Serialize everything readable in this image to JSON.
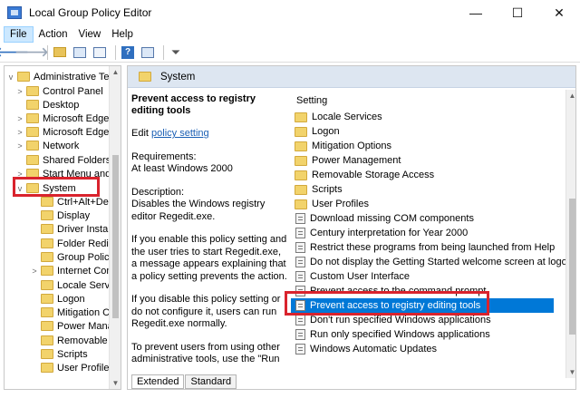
{
  "window": {
    "title": "Local Group Policy Editor",
    "minimize_glyph": "—",
    "maximize_glyph": "☐",
    "close_glyph": "✕"
  },
  "menu": [
    "File",
    "Action",
    "View",
    "Help"
  ],
  "toolbar_icons": [
    "back-arrow-icon",
    "forward-arrow-icon",
    "up-folder-icon",
    "show-hide-tree-icon",
    "export-list-icon",
    "help-icon",
    "properties-icon",
    "filter-icon"
  ],
  "tree": {
    "items": [
      {
        "label": "Administrative Templ",
        "chev": "v"
      },
      {
        "label": "Control Panel",
        "chev": ">"
      },
      {
        "label": "Desktop",
        "chev": ""
      },
      {
        "label": "Microsoft Edge",
        "chev": ">"
      },
      {
        "label": "Microsoft Edge",
        "chev": ">"
      },
      {
        "label": "Network",
        "chev": ">"
      },
      {
        "label": "Shared Folders",
        "chev": ""
      },
      {
        "label": "Start Menu and",
        "chev": ">"
      },
      {
        "label": "System",
        "chev": "v"
      },
      {
        "label": "Ctrl+Alt+De",
        "chev": ""
      },
      {
        "label": "Display",
        "chev": ""
      },
      {
        "label": "Driver Instal",
        "chev": ""
      },
      {
        "label": "Folder Redir",
        "chev": ""
      },
      {
        "label": "Group Policy",
        "chev": ""
      },
      {
        "label": "Internet Con",
        "chev": ">"
      },
      {
        "label": "Locale Servic",
        "chev": ""
      },
      {
        "label": "Logon",
        "chev": ""
      },
      {
        "label": "Mitigation C",
        "chev": ""
      },
      {
        "label": "Power Mana",
        "chev": ""
      },
      {
        "label": "Removable S",
        "chev": ""
      },
      {
        "label": "Scripts",
        "chev": ""
      },
      {
        "label": "User Profiles",
        "chev": ""
      }
    ]
  },
  "header": {
    "title": "System"
  },
  "description": {
    "title": "Prevent access to registry editing tools",
    "edit_prefix": "Edit",
    "edit_link": "policy setting",
    "requirements_label": "Requirements:",
    "requirements_value": "At least Windows 2000",
    "description_label": "Description:",
    "description_text": "Disables the Windows registry editor Regedit.exe.",
    "para1": "If you enable this policy setting and the user tries to start Regedit.exe, a message appears explaining that a policy setting prevents the action.",
    "para2": "If you disable this policy setting or do not configure it, users can run Regedit.exe normally.",
    "para3": "To prevent users from using other administrative tools, use the \"Run"
  },
  "list": {
    "column_header": "Setting",
    "rows": [
      {
        "label": "Locale Services",
        "type": "folder"
      },
      {
        "label": "Logon",
        "type": "folder"
      },
      {
        "label": "Mitigation Options",
        "type": "folder"
      },
      {
        "label": "Power Management",
        "type": "folder"
      },
      {
        "label": "Removable Storage Access",
        "type": "folder"
      },
      {
        "label": "Scripts",
        "type": "folder"
      },
      {
        "label": "User Profiles",
        "type": "folder"
      },
      {
        "label": "Download missing COM components",
        "type": "setting"
      },
      {
        "label": "Century interpretation for Year 2000",
        "type": "setting"
      },
      {
        "label": "Restrict these programs from being launched from Help",
        "type": "setting"
      },
      {
        "label": "Do not display the Getting Started welcome screen at logon",
        "type": "setting"
      },
      {
        "label": "Custom User Interface",
        "type": "setting"
      },
      {
        "label": "Prevent access to the command prompt",
        "type": "setting"
      },
      {
        "label": "Prevent access to registry editing tools",
        "type": "setting",
        "selected": true
      },
      {
        "label": "Don't run specified Windows applications",
        "type": "setting"
      },
      {
        "label": "Run only specified Windows applications",
        "type": "setting"
      },
      {
        "label": "Windows Automatic Updates",
        "type": "setting"
      }
    ]
  },
  "tabs": [
    "Extended",
    "Standard"
  ],
  "colors": {
    "highlight_box": "#d9232d",
    "selection": "#0078d7",
    "header_bg": "#dde6f1"
  }
}
